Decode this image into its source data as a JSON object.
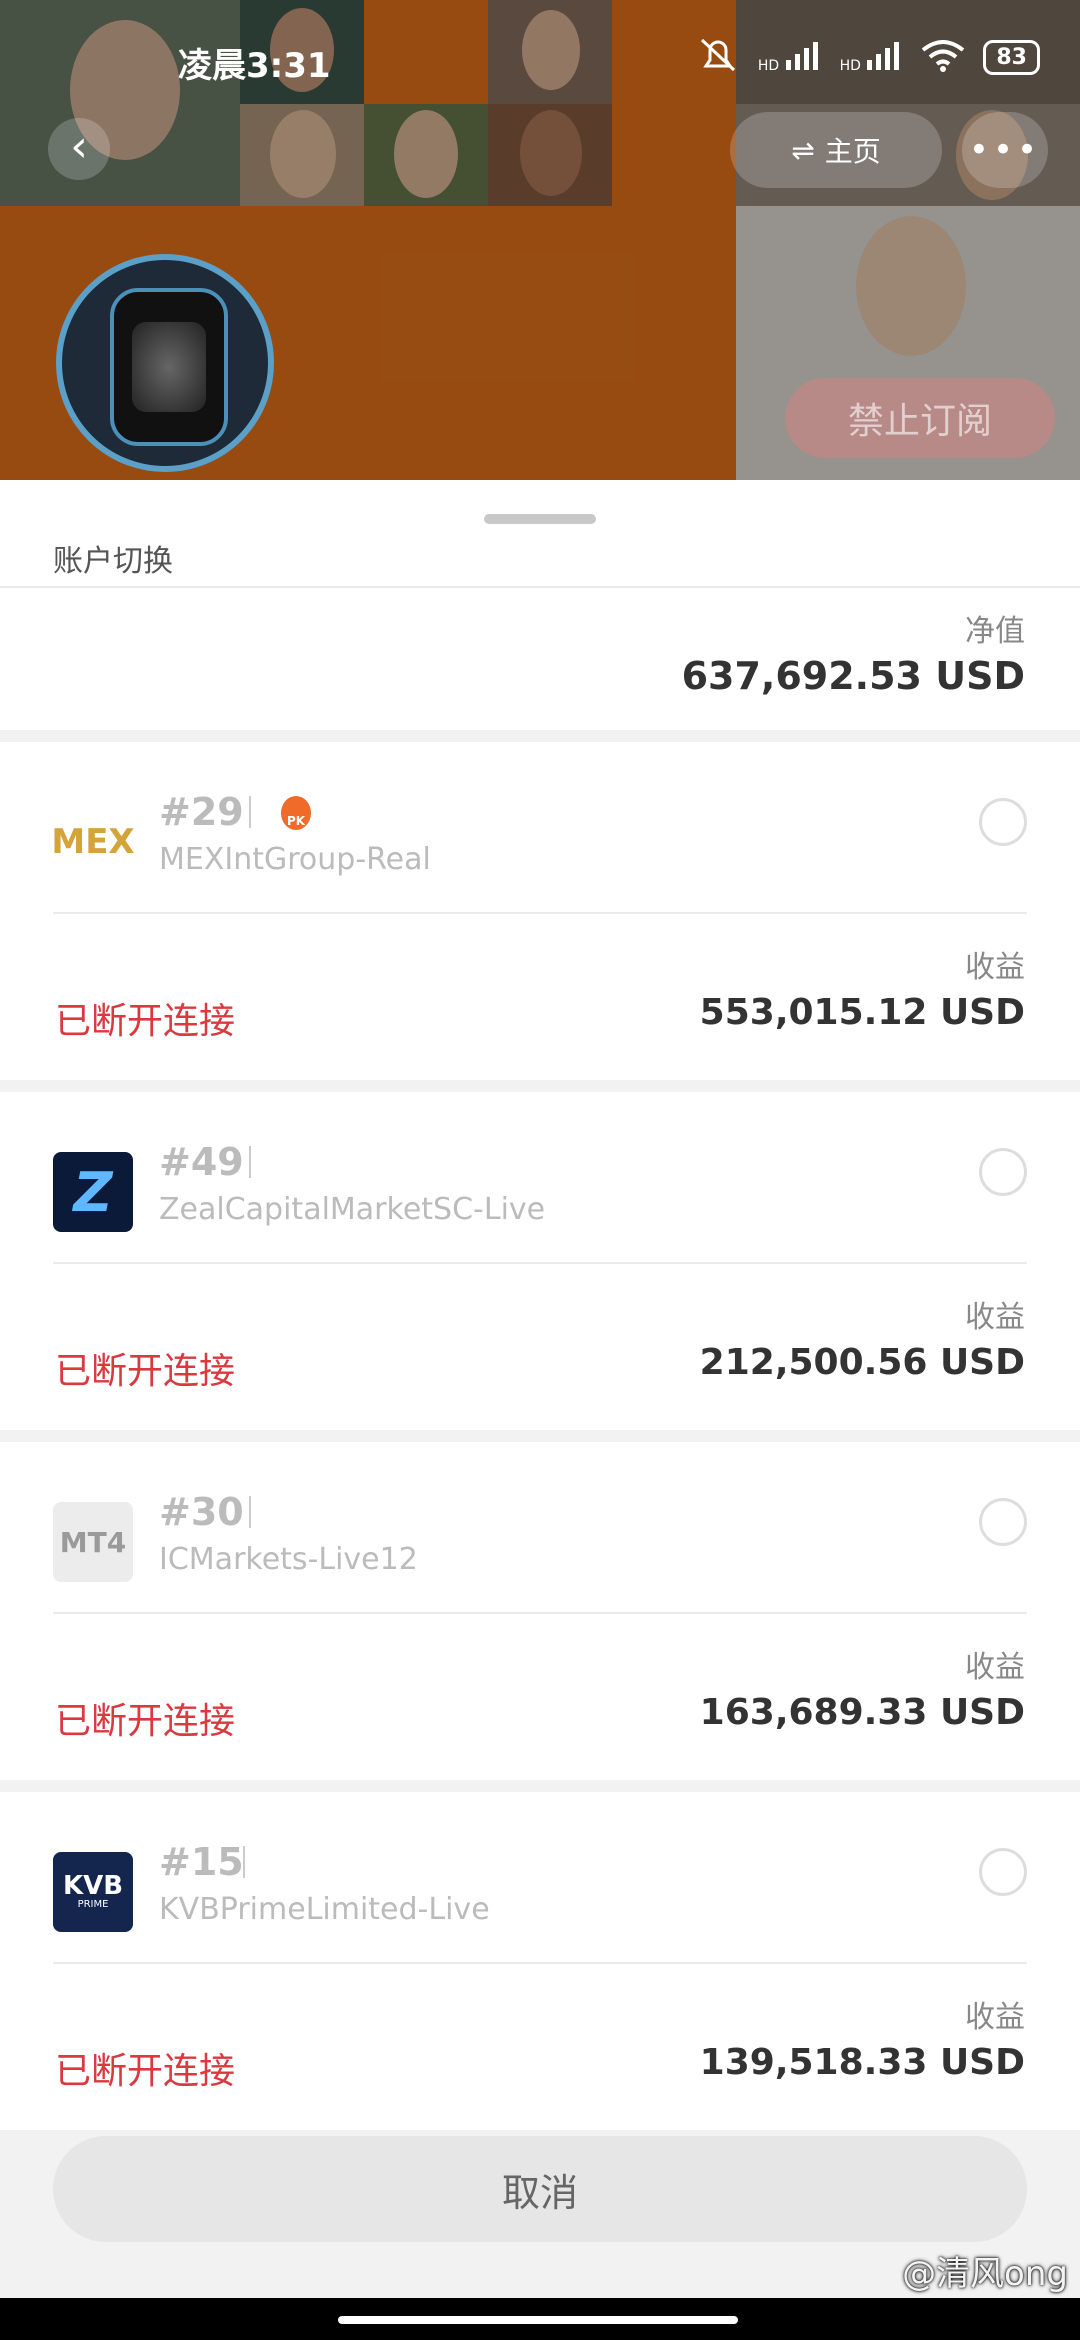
{
  "status_bar": {
    "time": "凌晨3:31",
    "battery": "83",
    "signal_label": "HD"
  },
  "nav": {
    "home_label": "主页",
    "home_icon": "switch-icon",
    "back_icon": "chevron-left-icon",
    "more_icon": "more-dots-icon"
  },
  "profile": {
    "subscribe_button": "禁止订阅"
  },
  "sheet": {
    "title": "账户切换",
    "equity_label": "净值",
    "equity_value": "637,692.53 USD",
    "cancel_label": "取消"
  },
  "accounts": [
    {
      "id": "#29",
      "server": "MEXIntGroup-Real",
      "logo_text": "MEX",
      "badge": "PK",
      "status": "已断开连接",
      "profit_label": "收益",
      "profit": "553,015.12 USD"
    },
    {
      "id": "#49",
      "server": "ZealCapitalMarketSC-Live",
      "logo_text": "Z",
      "status": "已断开连接",
      "profit_label": "收益",
      "profit": "212,500.56 USD"
    },
    {
      "id": "#30",
      "server": "ICMarkets-Live12",
      "logo_text": "MT4",
      "status": "已断开连接",
      "profit_label": "收益",
      "profit": "163,689.33 USD"
    },
    {
      "id": "#15",
      "server": "KVBPrimeLimited-Live",
      "logo_text": "KVB",
      "logo_subtext": "PRIME",
      "status": "已断开连接",
      "profit_label": "收益",
      "profit": "139,518.33 USD"
    }
  ],
  "watermark": "@清风ong",
  "colors": {
    "disconnected": "#d9393f",
    "accent_orange": "#e8741a"
  }
}
